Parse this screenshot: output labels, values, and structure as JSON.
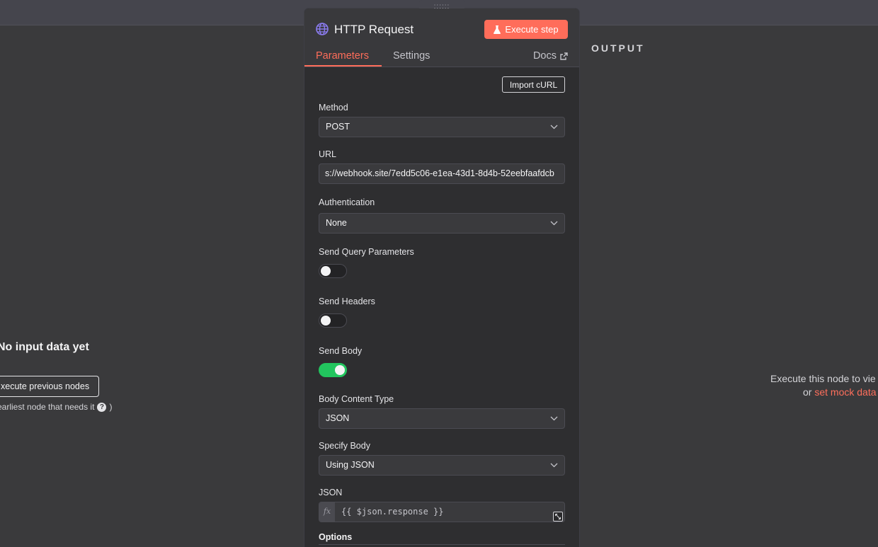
{
  "input_pane": {
    "title": "No input data yet",
    "button_label": "xecute previous nodes",
    "note_text": "earliest node that needs it",
    "note_close": ")"
  },
  "output_pane": {
    "label": "OUTPUT",
    "message_line1": "Execute this node to vie",
    "message_or": "or",
    "mock_link": "set mock data"
  },
  "node": {
    "title": "HTTP Request",
    "execute_label": "Execute step",
    "tabs": [
      {
        "label": "Parameters",
        "active": true
      },
      {
        "label": "Settings",
        "active": false
      }
    ],
    "docs_label": "Docs",
    "handle": "::::::"
  },
  "params": {
    "import_curl": "Import cURL",
    "method": {
      "label": "Method",
      "value": "POST"
    },
    "url": {
      "label": "URL",
      "value": "s://webhook.site/7edd5c06-e1ea-43d1-8d4b-52eebfaafdcb"
    },
    "authentication": {
      "label": "Authentication",
      "value": "None"
    },
    "send_query": {
      "label": "Send Query Parameters",
      "on": false
    },
    "send_headers": {
      "label": "Send Headers",
      "on": false
    },
    "send_body": {
      "label": "Send Body",
      "on": true
    },
    "body_content_type": {
      "label": "Body Content Type",
      "value": "JSON"
    },
    "specify_body": {
      "label": "Specify Body",
      "value": "Using JSON"
    },
    "json": {
      "label": "JSON",
      "fx": "fx",
      "value": "{{ $json.response }}"
    },
    "options_label": "Options"
  },
  "colors": {
    "accent": "#ff6d5a",
    "toggle_on": "#22c55e",
    "panel_bg": "#2e2e30"
  }
}
